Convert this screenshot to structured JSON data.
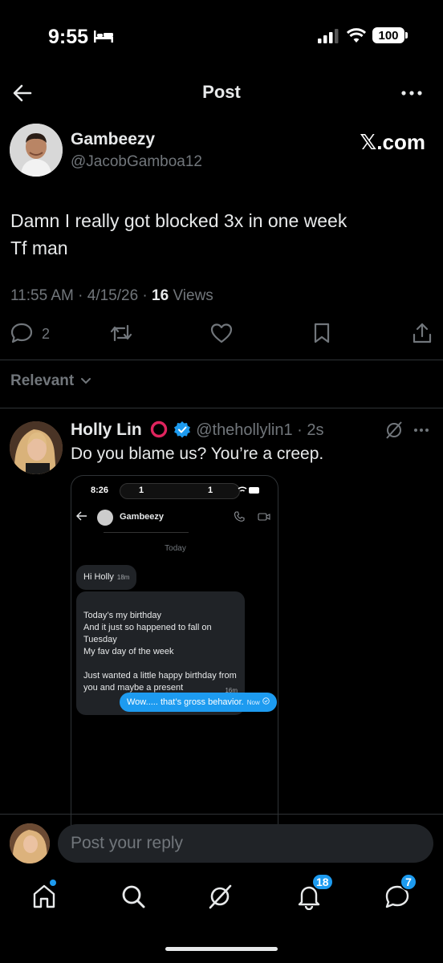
{
  "status_bar": {
    "time": "9:55",
    "battery": "100"
  },
  "header": {
    "title": "Post"
  },
  "post": {
    "author_name": "Gambeezy",
    "author_handle": "@JacobGamboa12",
    "brand": "𝕏.com",
    "text_line1": "Damn I really got blocked 3x in one week",
    "text_line2": "Tf man",
    "time": "11:55 AM · 4/15/26 · ",
    "views_count": "16",
    "views_label": " Views",
    "reply_count": "2"
  },
  "sort": {
    "label": "Relevant"
  },
  "reply": {
    "name": "Holly Lin",
    "handle": "@thehollylin1 · 2s",
    "text": "Do you blame us? You’re a creep."
  },
  "embedded_screenshot": {
    "time": "8:26",
    "pill_left": "1",
    "pill_right": "1",
    "chat_name": "Gambeezy",
    "day": "Today",
    "msg1_text": "Hi Holly",
    "msg1_time": "18m",
    "msg2_text": "Today’s my birthday\nAnd it just so happened to fall on Tuesday\nMy fav day of the week\n\nJust wanted a little happy birthday from you and maybe a present",
    "msg2_time": "16m",
    "msg3_text": "Wow..... that’s gross behavior.",
    "msg3_time": "Now"
  },
  "composer": {
    "placeholder": "Post your reply"
  },
  "nav": {
    "notifications_badge": "18",
    "messages_badge": "7"
  },
  "colors": {
    "accent": "#1d9bf0",
    "muted": "#71767b",
    "text": "#e7e9ea",
    "background": "#000000"
  }
}
